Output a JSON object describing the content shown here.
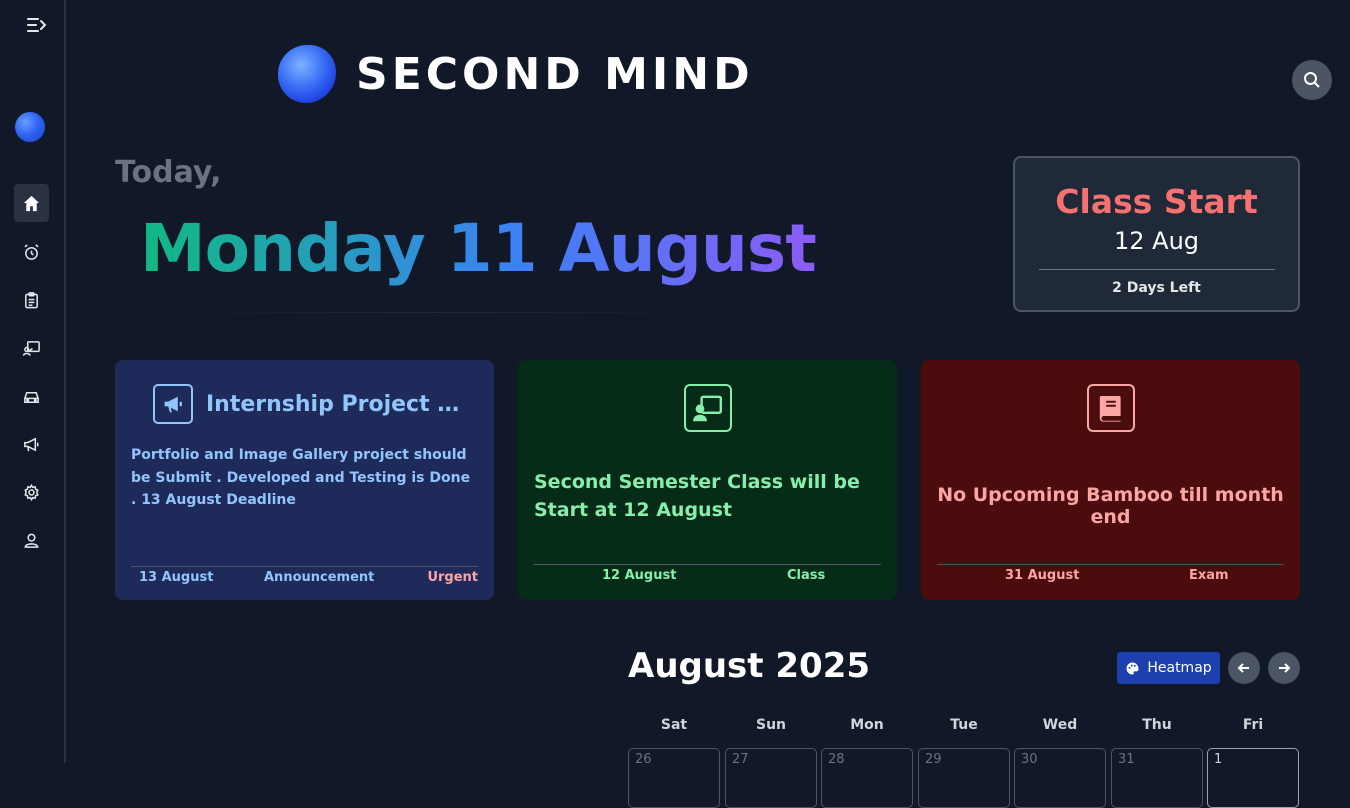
{
  "app": {
    "name": "SECOND MIND"
  },
  "header": {
    "today_label": "Today,",
    "date_weekday": "Monday",
    "date_day": "11",
    "date_month": "August"
  },
  "countdown": {
    "title": "Class Start",
    "date": "12 Aug",
    "remaining": "2 Days Left"
  },
  "cards": [
    {
      "title": "Internship Project S...",
      "description": "Portfolio and Image Gallery project should be Submit . Developed and Testing is Done . 13 August Deadline",
      "date": "13 August",
      "category": "Announcement",
      "priority": "Urgent",
      "icon": "megaphone-icon",
      "color": "#93c5fd"
    },
    {
      "description": "Second Semester Class will be Start at 12 August",
      "date": "12 August",
      "category": "Class",
      "icon": "chalkboard-teacher-icon",
      "color": "#86efac"
    },
    {
      "description": "No Upcoming Bamboo till month end",
      "date": "31 August",
      "category": "Exam",
      "icon": "book-icon",
      "color": "#fca5a5"
    }
  ],
  "calendar": {
    "title": "August 2025",
    "heatmap_label": "Heatmap",
    "weekdays": [
      "Sat",
      "Sun",
      "Mon",
      "Tue",
      "Wed",
      "Thu",
      "Fri"
    ],
    "first_row": [
      "26",
      "27",
      "28",
      "29",
      "30",
      "31",
      "1"
    ]
  },
  "colors": {
    "background": "#111827",
    "accent": "#1e40af",
    "urgent": "#f87171"
  }
}
